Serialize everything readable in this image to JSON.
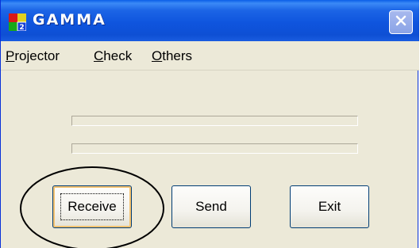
{
  "window": {
    "title": "GAMMA",
    "icon": "gamma-app-icon",
    "close_icon": "close-icon"
  },
  "menu": {
    "items": [
      {
        "mnemonic": "P",
        "rest": "rojector"
      },
      {
        "mnemonic": "C",
        "rest": "heck"
      },
      {
        "mnemonic": "O",
        "rest": "thers"
      }
    ]
  },
  "progress_bars": [
    {
      "value": 0
    },
    {
      "value": 0
    }
  ],
  "buttons": {
    "receive": "Receive",
    "send": "Send",
    "exit": "Exit"
  },
  "annotation": {
    "type": "ellipse",
    "target": "receive-button",
    "color": "#000000"
  }
}
